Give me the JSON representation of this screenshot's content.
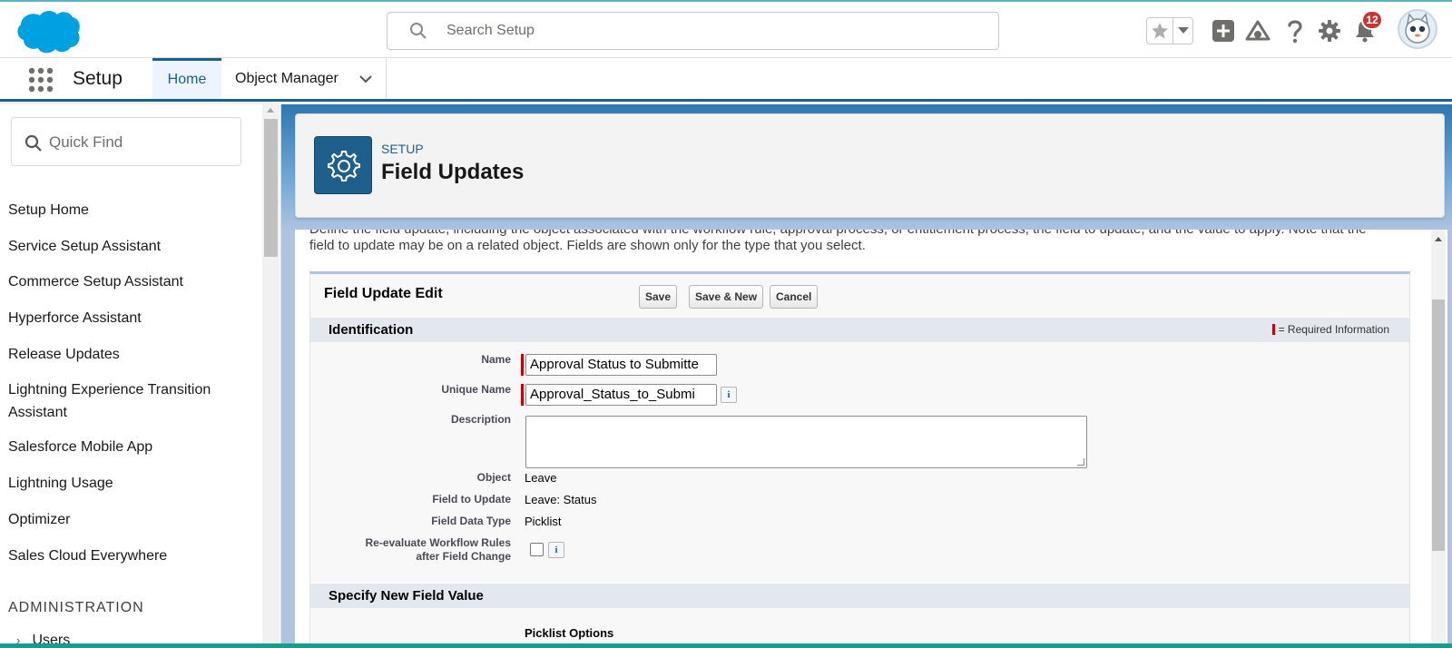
{
  "header": {
    "search_placeholder": "Search Setup",
    "notification_count": "12",
    "icons": [
      "favorites-star-icon",
      "chevron-down-icon",
      "global-actions-add-icon",
      "trailhead-icon",
      "help-icon",
      "gear-icon",
      "bell-icon",
      "avatar"
    ]
  },
  "nav": {
    "app_name": "Setup",
    "tabs": [
      {
        "label": "Home",
        "active": true
      },
      {
        "label": "Object Manager",
        "active": false
      }
    ]
  },
  "sidebar": {
    "quickfind_placeholder": "Quick Find",
    "items": [
      {
        "label": "Setup Home"
      },
      {
        "label": "Service Setup Assistant"
      },
      {
        "label": "Commerce Setup Assistant"
      },
      {
        "label": "Hyperforce Assistant"
      },
      {
        "label": "Release Updates"
      },
      {
        "label": "Lightning Experience Transition Assistant"
      },
      {
        "label": "Salesforce Mobile App"
      },
      {
        "label": "Lightning Usage"
      },
      {
        "label": "Optimizer"
      },
      {
        "label": "Sales Cloud Everywhere"
      }
    ],
    "section": "ADMINISTRATION",
    "section_item": "Users"
  },
  "page_header": {
    "eyebrow": "SETUP",
    "title": "Field Updates"
  },
  "content": {
    "description_cut": "Define the field update, including the object associated with the workflow rule, approval process, or entitlement process, the field to update, and the value to apply. Note that the",
    "description": "field to update may be on a related object. Fields are shown only for the type that you select."
  },
  "form": {
    "title": "Field Update Edit",
    "buttons": {
      "save": "Save",
      "save_new": "Save & New",
      "cancel": "Cancel"
    },
    "identification": {
      "title": "Identification",
      "required_info": "= Required Information"
    },
    "fields": {
      "name_label": "Name",
      "name_value": "Approval Status to Submitte",
      "unique_name_label": "Unique Name",
      "unique_name_value": "Approval_Status_to_Submi",
      "description_label": "Description",
      "description_value": "",
      "object_label": "Object",
      "object_value": "Leave",
      "field_to_update_label": "Field to Update",
      "field_to_update_value": "Leave: Status",
      "field_data_type_label": "Field Data Type",
      "field_data_type_value": "Picklist",
      "reevaluate_label_1": "Re-evaluate Workflow Rules",
      "reevaluate_label_2": "after Field Change",
      "reevaluate_checked": false
    },
    "new_value_section": {
      "title": "Specify New Field Value",
      "picklist_options": "Picklist Options"
    }
  },
  "colors": {
    "brand_blue": "#1f5f8b",
    "required_red": "#c00",
    "badge_red": "#c23934",
    "salesforce_cloud": "#00a1e0"
  }
}
